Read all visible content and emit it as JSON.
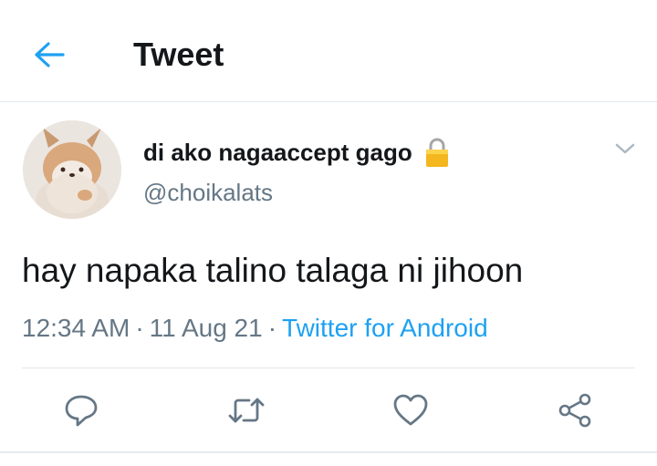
{
  "header": {
    "title": "Tweet",
    "back_icon": "arrow-left-icon",
    "accent": "#1da1f2"
  },
  "tweet": {
    "author": {
      "display_name": "di ako nagaaccept gago",
      "handle": "@choikalats",
      "protected_icon": "lock-icon",
      "avatar": "plush-corgi-avatar"
    },
    "text": "hay napaka talino talaga ni jihoon",
    "time": "12:34 AM",
    "date": "11 Aug 21",
    "separator": "·",
    "source": "Twitter for Android",
    "menu_icon": "chevron-down-icon"
  },
  "actions": [
    {
      "name": "reply",
      "icon": "reply-icon"
    },
    {
      "name": "retweet",
      "icon": "retweet-icon"
    },
    {
      "name": "like",
      "icon": "heart-icon"
    },
    {
      "name": "share",
      "icon": "share-icon"
    }
  ],
  "colors": {
    "text": "#14171a",
    "secondary": "#657786",
    "link": "#1da1f2",
    "divider": "#e1e8ed"
  }
}
